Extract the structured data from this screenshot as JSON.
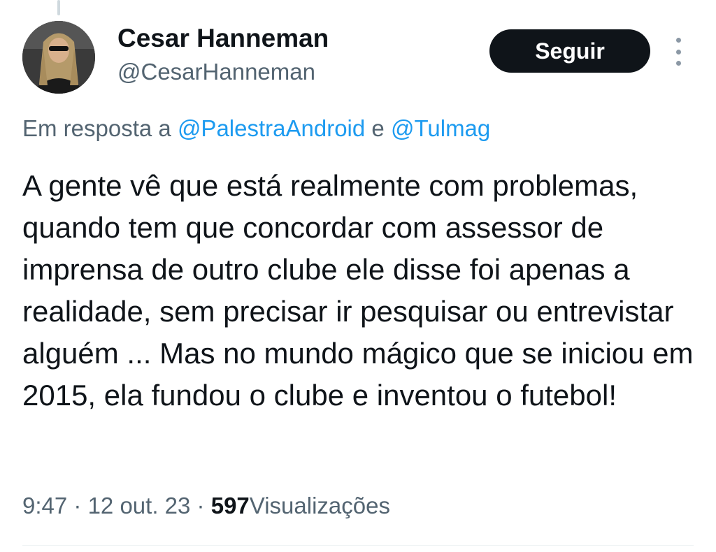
{
  "author": {
    "display_name": "Cesar Hanneman",
    "handle": "@CesarHanneman",
    "avatar": "profile-photo"
  },
  "actions": {
    "follow_label": "Seguir",
    "more_icon": "more-vertical-icon"
  },
  "reply": {
    "prefix": "Em resposta a",
    "mention_1": "@PalestraAndroid",
    "joiner": "e",
    "mention_2": "@Tulmag"
  },
  "tweet": {
    "text": "A gente vê que está realmente com problemas, quando tem que concordar com assessor de imprensa de outro clube ele disse foi apenas a realidade, sem precisar ir pesquisar ou entrevistar alguém ... Mas no mundo mágico que se iniciou em 2015, ela fundou o clube e inventou o futebol!"
  },
  "meta": {
    "time": "9:47",
    "separator": "·",
    "date": "12 out. 23",
    "views_count": "597",
    "views_label": "Visualizações"
  },
  "colors": {
    "text": "#0f1419",
    "secondary": "#536471",
    "link": "#1d9bf0",
    "button_bg": "#0f1419"
  }
}
